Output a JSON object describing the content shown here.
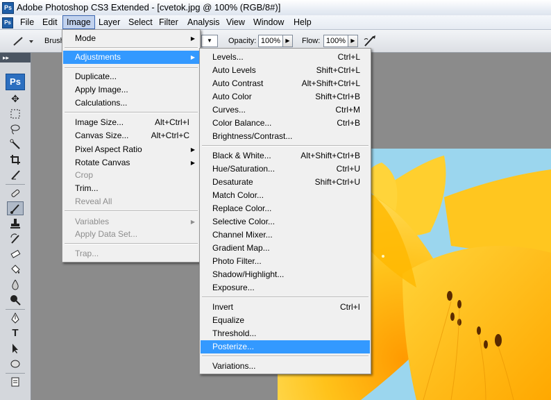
{
  "window": {
    "title": "Adobe Photoshop CS3 Extended - [cvetok.jpg @ 100% (RGB/8#)]",
    "app_icon": "Ps"
  },
  "menubar": {
    "items": [
      {
        "label": "File"
      },
      {
        "label": "Edit"
      },
      {
        "label": "Image"
      },
      {
        "label": "Layer"
      },
      {
        "label": "Select"
      },
      {
        "label": "Filter"
      },
      {
        "label": "Analysis"
      },
      {
        "label": "View"
      },
      {
        "label": "Window"
      },
      {
        "label": "Help"
      }
    ],
    "active": "Image"
  },
  "options_bar": {
    "brush_label": "Brush",
    "opacity_label": "Opacity:",
    "opacity_value": "100%",
    "flow_label": "Flow:",
    "flow_value": "100%"
  },
  "tools_panel": {
    "logo": "Ps",
    "tools": [
      "move-tool-icon",
      "marquee-tool-icon",
      "lasso-tool-icon",
      "magic-wand-icon",
      "crop-tool-icon",
      "slice-tool-icon",
      "healing-brush-icon",
      "brush-tool-icon",
      "clone-stamp-icon",
      "history-brush-icon",
      "eraser-tool-icon",
      "paint-bucket-icon",
      "blur-tool-icon",
      "dodge-tool-icon",
      "pen-tool-icon",
      "type-tool-icon",
      "path-selection-icon",
      "shape-tool-icon",
      "notes-tool-icon"
    ],
    "type_tool_glyph": "T",
    "selected": "brush-tool-icon"
  },
  "image_menu": {
    "items": [
      {
        "label": "Mode",
        "submenu": true
      },
      {
        "separator": true
      },
      {
        "label": "Adjustments",
        "submenu": true,
        "highlighted": true
      },
      {
        "separator": true
      },
      {
        "label": "Duplicate..."
      },
      {
        "label": "Apply Image..."
      },
      {
        "label": "Calculations..."
      },
      {
        "separator": true
      },
      {
        "label": "Image Size...",
        "shortcut": "Alt+Ctrl+I"
      },
      {
        "label": "Canvas Size...",
        "shortcut": "Alt+Ctrl+C"
      },
      {
        "label": "Pixel Aspect Ratio",
        "submenu": true
      },
      {
        "label": "Rotate Canvas",
        "submenu": true
      },
      {
        "label": "Crop",
        "disabled": true
      },
      {
        "label": "Trim..."
      },
      {
        "label": "Reveal All",
        "disabled": true
      },
      {
        "separator": true
      },
      {
        "label": "Variables",
        "submenu": true,
        "disabled": true
      },
      {
        "label": "Apply Data Set...",
        "disabled": true
      },
      {
        "separator": true
      },
      {
        "label": "Trap...",
        "disabled": true
      }
    ]
  },
  "adjustments_menu": {
    "items": [
      {
        "label": "Levels...",
        "shortcut": "Ctrl+L"
      },
      {
        "label": "Auto Levels",
        "shortcut": "Shift+Ctrl+L"
      },
      {
        "label": "Auto Contrast",
        "shortcut": "Alt+Shift+Ctrl+L"
      },
      {
        "label": "Auto Color",
        "shortcut": "Shift+Ctrl+B"
      },
      {
        "label": "Curves...",
        "shortcut": "Ctrl+M"
      },
      {
        "label": "Color Balance...",
        "shortcut": "Ctrl+B"
      },
      {
        "label": "Brightness/Contrast..."
      },
      {
        "separator": true
      },
      {
        "label": "Black & White...",
        "shortcut": "Alt+Shift+Ctrl+B"
      },
      {
        "label": "Hue/Saturation...",
        "shortcut": "Ctrl+U"
      },
      {
        "label": "Desaturate",
        "shortcut": "Shift+Ctrl+U"
      },
      {
        "label": "Match Color..."
      },
      {
        "label": "Replace Color..."
      },
      {
        "label": "Selective Color..."
      },
      {
        "label": "Channel Mixer..."
      },
      {
        "label": "Gradient Map..."
      },
      {
        "label": "Photo Filter..."
      },
      {
        "label": "Shadow/Highlight..."
      },
      {
        "label": "Exposure..."
      },
      {
        "separator": true
      },
      {
        "label": "Invert",
        "shortcut": "Ctrl+I"
      },
      {
        "label": "Equalize"
      },
      {
        "label": "Threshold..."
      },
      {
        "label": "Posterize...",
        "highlighted": true
      },
      {
        "separator": true
      },
      {
        "label": "Variations..."
      }
    ]
  },
  "colors": {
    "menu_highlight": "#3399ff",
    "menubar_active": "#c1d2ee",
    "workspace": "#8b8b8b"
  }
}
